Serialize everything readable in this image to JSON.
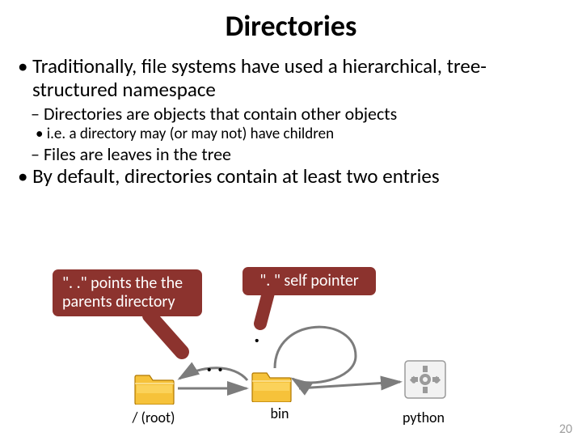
{
  "title": "Directories",
  "bullets": {
    "b1": "Traditionally, file systems have used a hierarchical, tree-structured namespace",
    "b1a": "Directories are objects that contain other objects",
    "b1a1": "i.e. a directory may (or may not) have children",
    "b1b": "Files are leaves in the tree",
    "b2": "By default, directories contain at least two entries"
  },
  "callouts": {
    "parent": "\". .\" points the the parents directory",
    "self": "\". \" self pointer"
  },
  "diagram": {
    "root_label": "/ (root)",
    "bin_label": "bin",
    "python_label": "python",
    "dot": ".",
    "dotdot": ". ."
  },
  "page_number": "20"
}
